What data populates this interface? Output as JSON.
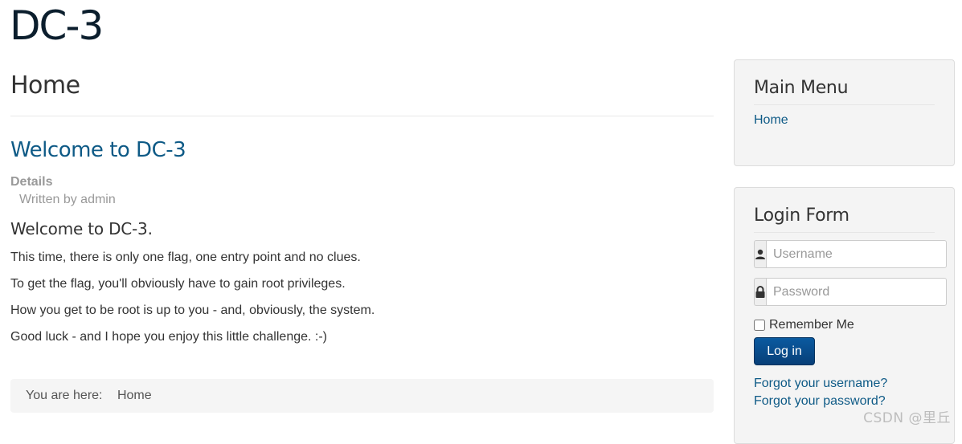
{
  "site": {
    "title": "DC-3"
  },
  "main": {
    "page_header": "Home",
    "article": {
      "title": "Welcome to DC-3",
      "details_label": "Details",
      "written_by": "Written by admin",
      "heading": "Welcome to DC-3.",
      "paragraphs": [
        "This time, there is only one flag, one entry point and no clues.",
        "To get the flag, you'll obviously have to gain root privileges.",
        "How you get to be root is up to you - and, obviously, the system.",
        "Good luck - and I hope you enjoy this little challenge.  :-)"
      ]
    },
    "breadcrumb": {
      "label": "You are here:",
      "items": [
        "Home"
      ]
    }
  },
  "sidebar": {
    "main_menu": {
      "title": "Main Menu",
      "items": [
        "Home"
      ]
    },
    "login_form": {
      "title": "Login Form",
      "username_placeholder": "Username",
      "password_placeholder": "Password",
      "remember_label": "Remember Me",
      "login_button": "Log in",
      "forgot_username": "Forgot your username?",
      "forgot_password": "Forgot your password?",
      "icons": [
        "user-icon",
        "lock-icon"
      ]
    }
  },
  "watermark": "CSDN @里丘"
}
